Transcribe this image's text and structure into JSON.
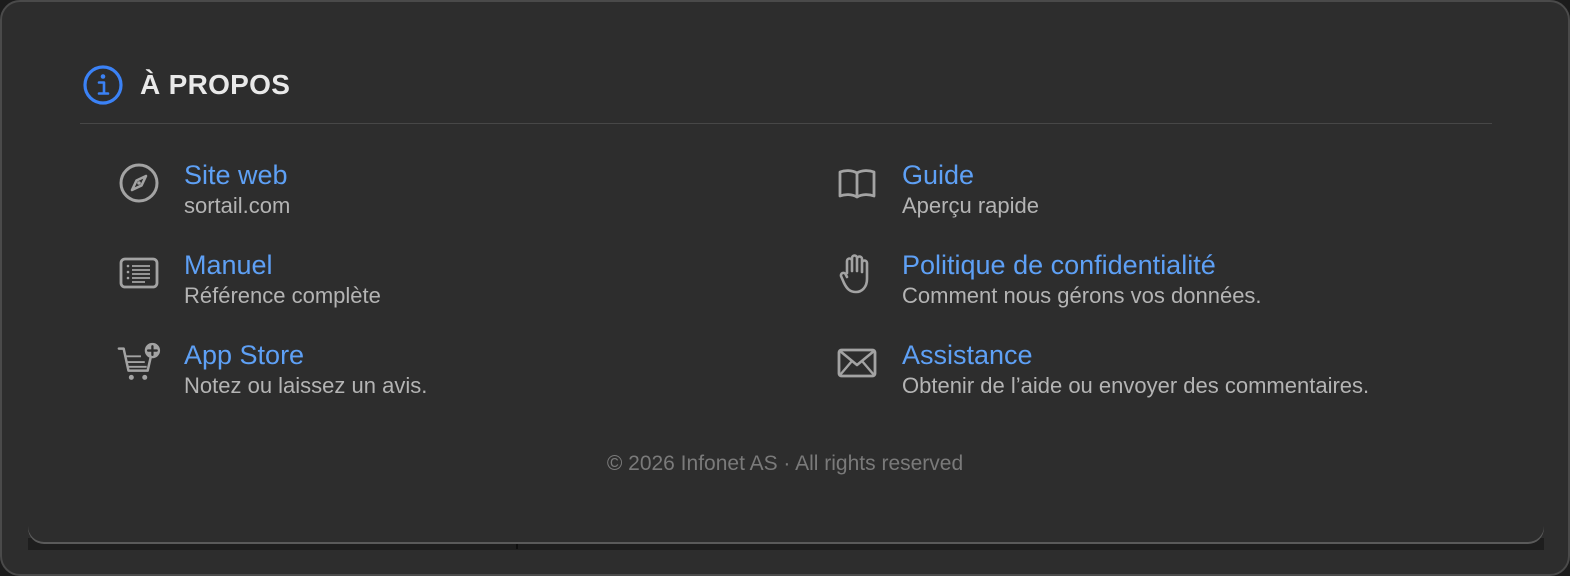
{
  "section": {
    "title": "À PROPOS",
    "icon": "info-circle-icon",
    "accent": "#3b82f6"
  },
  "items": [
    {
      "title": "Site web",
      "subtitle": "sortail.com",
      "icon": "compass-icon"
    },
    {
      "title": "Guide",
      "subtitle": "Aperçu rapide",
      "icon": "book-icon"
    },
    {
      "title": "Manuel",
      "subtitle": "Référence complète",
      "icon": "document-list-icon"
    },
    {
      "title": "Politique de confidentialité",
      "subtitle": "Comment nous gérons vos données.",
      "icon": "hand-icon"
    },
    {
      "title": "App Store",
      "subtitle": "Notez ou laissez un avis.",
      "icon": "cart-plus-icon"
    },
    {
      "title": "Assistance",
      "subtitle": "Obtenir de l’aide ou envoyer des commentaires.",
      "icon": "envelope-icon"
    }
  ],
  "footer": {
    "copyright": "© 2026 Infonet AS · All rights reserved"
  },
  "colors": {
    "link": "#5ea0f5",
    "subtitle": "#b4b4b4",
    "background": "#2d2d2d"
  }
}
